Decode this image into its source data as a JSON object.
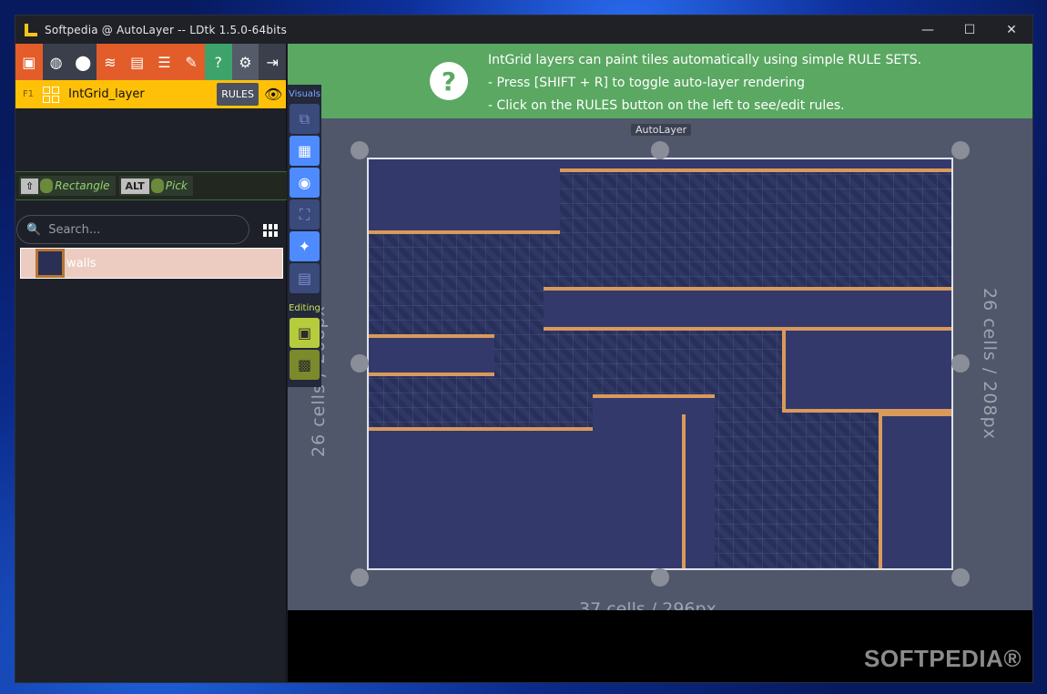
{
  "window": {
    "title": "Softpedia  @ AutoLayer    --    LDtk 1.5.0-64bits",
    "controls": {
      "minimize": "—",
      "maximize": "☐",
      "close": "✕"
    }
  },
  "toolbar": {
    "icons": [
      "project-settings-icon",
      "world-icon",
      "levels-icon",
      "layers-icon",
      "entities-icon",
      "enums-icon",
      "tilesets-icon",
      "help-icon",
      "settings-icon",
      "exit-icon"
    ]
  },
  "layer": {
    "shortcut": "F1",
    "name": "IntGrid_layer",
    "rules_label": "RULES"
  },
  "hints": [
    {
      "key": "⇧",
      "label": "Rectangle"
    },
    {
      "key": "ALT",
      "label": "Pick"
    }
  ],
  "search": {
    "placeholder": "Search..."
  },
  "ruleset": {
    "label": "walls"
  },
  "tool_strip": {
    "visuals_label": "Visuals",
    "editing_label": "Editing"
  },
  "banner": {
    "line1": "IntGrid layers can paint tiles automatically using simple RULE SETS.",
    "line2": "- Press [SHIFT + R] to toggle auto-layer rendering",
    "line3": "- Click on the RULES button on the left to see/edit rules."
  },
  "canvas": {
    "level_name": "AutoLayer",
    "height_label": "26 cells / 208px",
    "width_label": "37 cells / 296px"
  },
  "watermark": "SOFTPEDIA®",
  "colors": {
    "accent_layer": "#ffc107",
    "banner": "#5aa862",
    "orange_tool": "#e35d2a",
    "visuals": "#4d8bff",
    "editing": "#b6cc3d"
  }
}
